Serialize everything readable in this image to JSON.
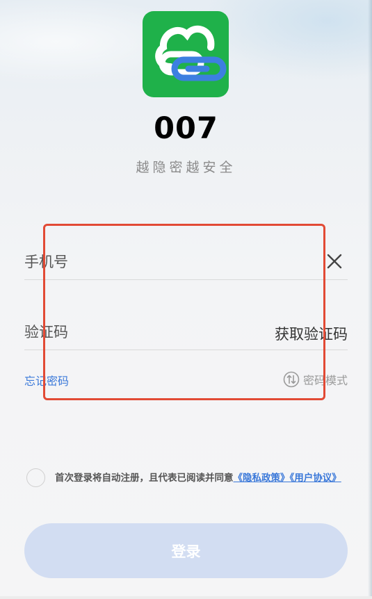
{
  "app": {
    "name": "007",
    "slogan": "越隐密越安全",
    "logo_icon": "chain-cloud-logo",
    "brand_color": "#1fb14a"
  },
  "form": {
    "phone_placeholder": "手机号",
    "phone_value": "",
    "code_placeholder": "验证码",
    "code_value": "",
    "get_code_label": "获取验证码",
    "forgot_password_label": "忘记密码",
    "password_mode_label": "密码模式"
  },
  "agreement": {
    "text": "首次登录将自动注册，且代表已阅读并同意",
    "privacy_link": "《隐私政策》",
    "user_link": "《用户协议》",
    "checked": false
  },
  "login_button": {
    "label": "登录",
    "color": "#d2ddf2"
  },
  "colors": {
    "link": "#3a78d9",
    "highlight_box": "#e24a35"
  }
}
